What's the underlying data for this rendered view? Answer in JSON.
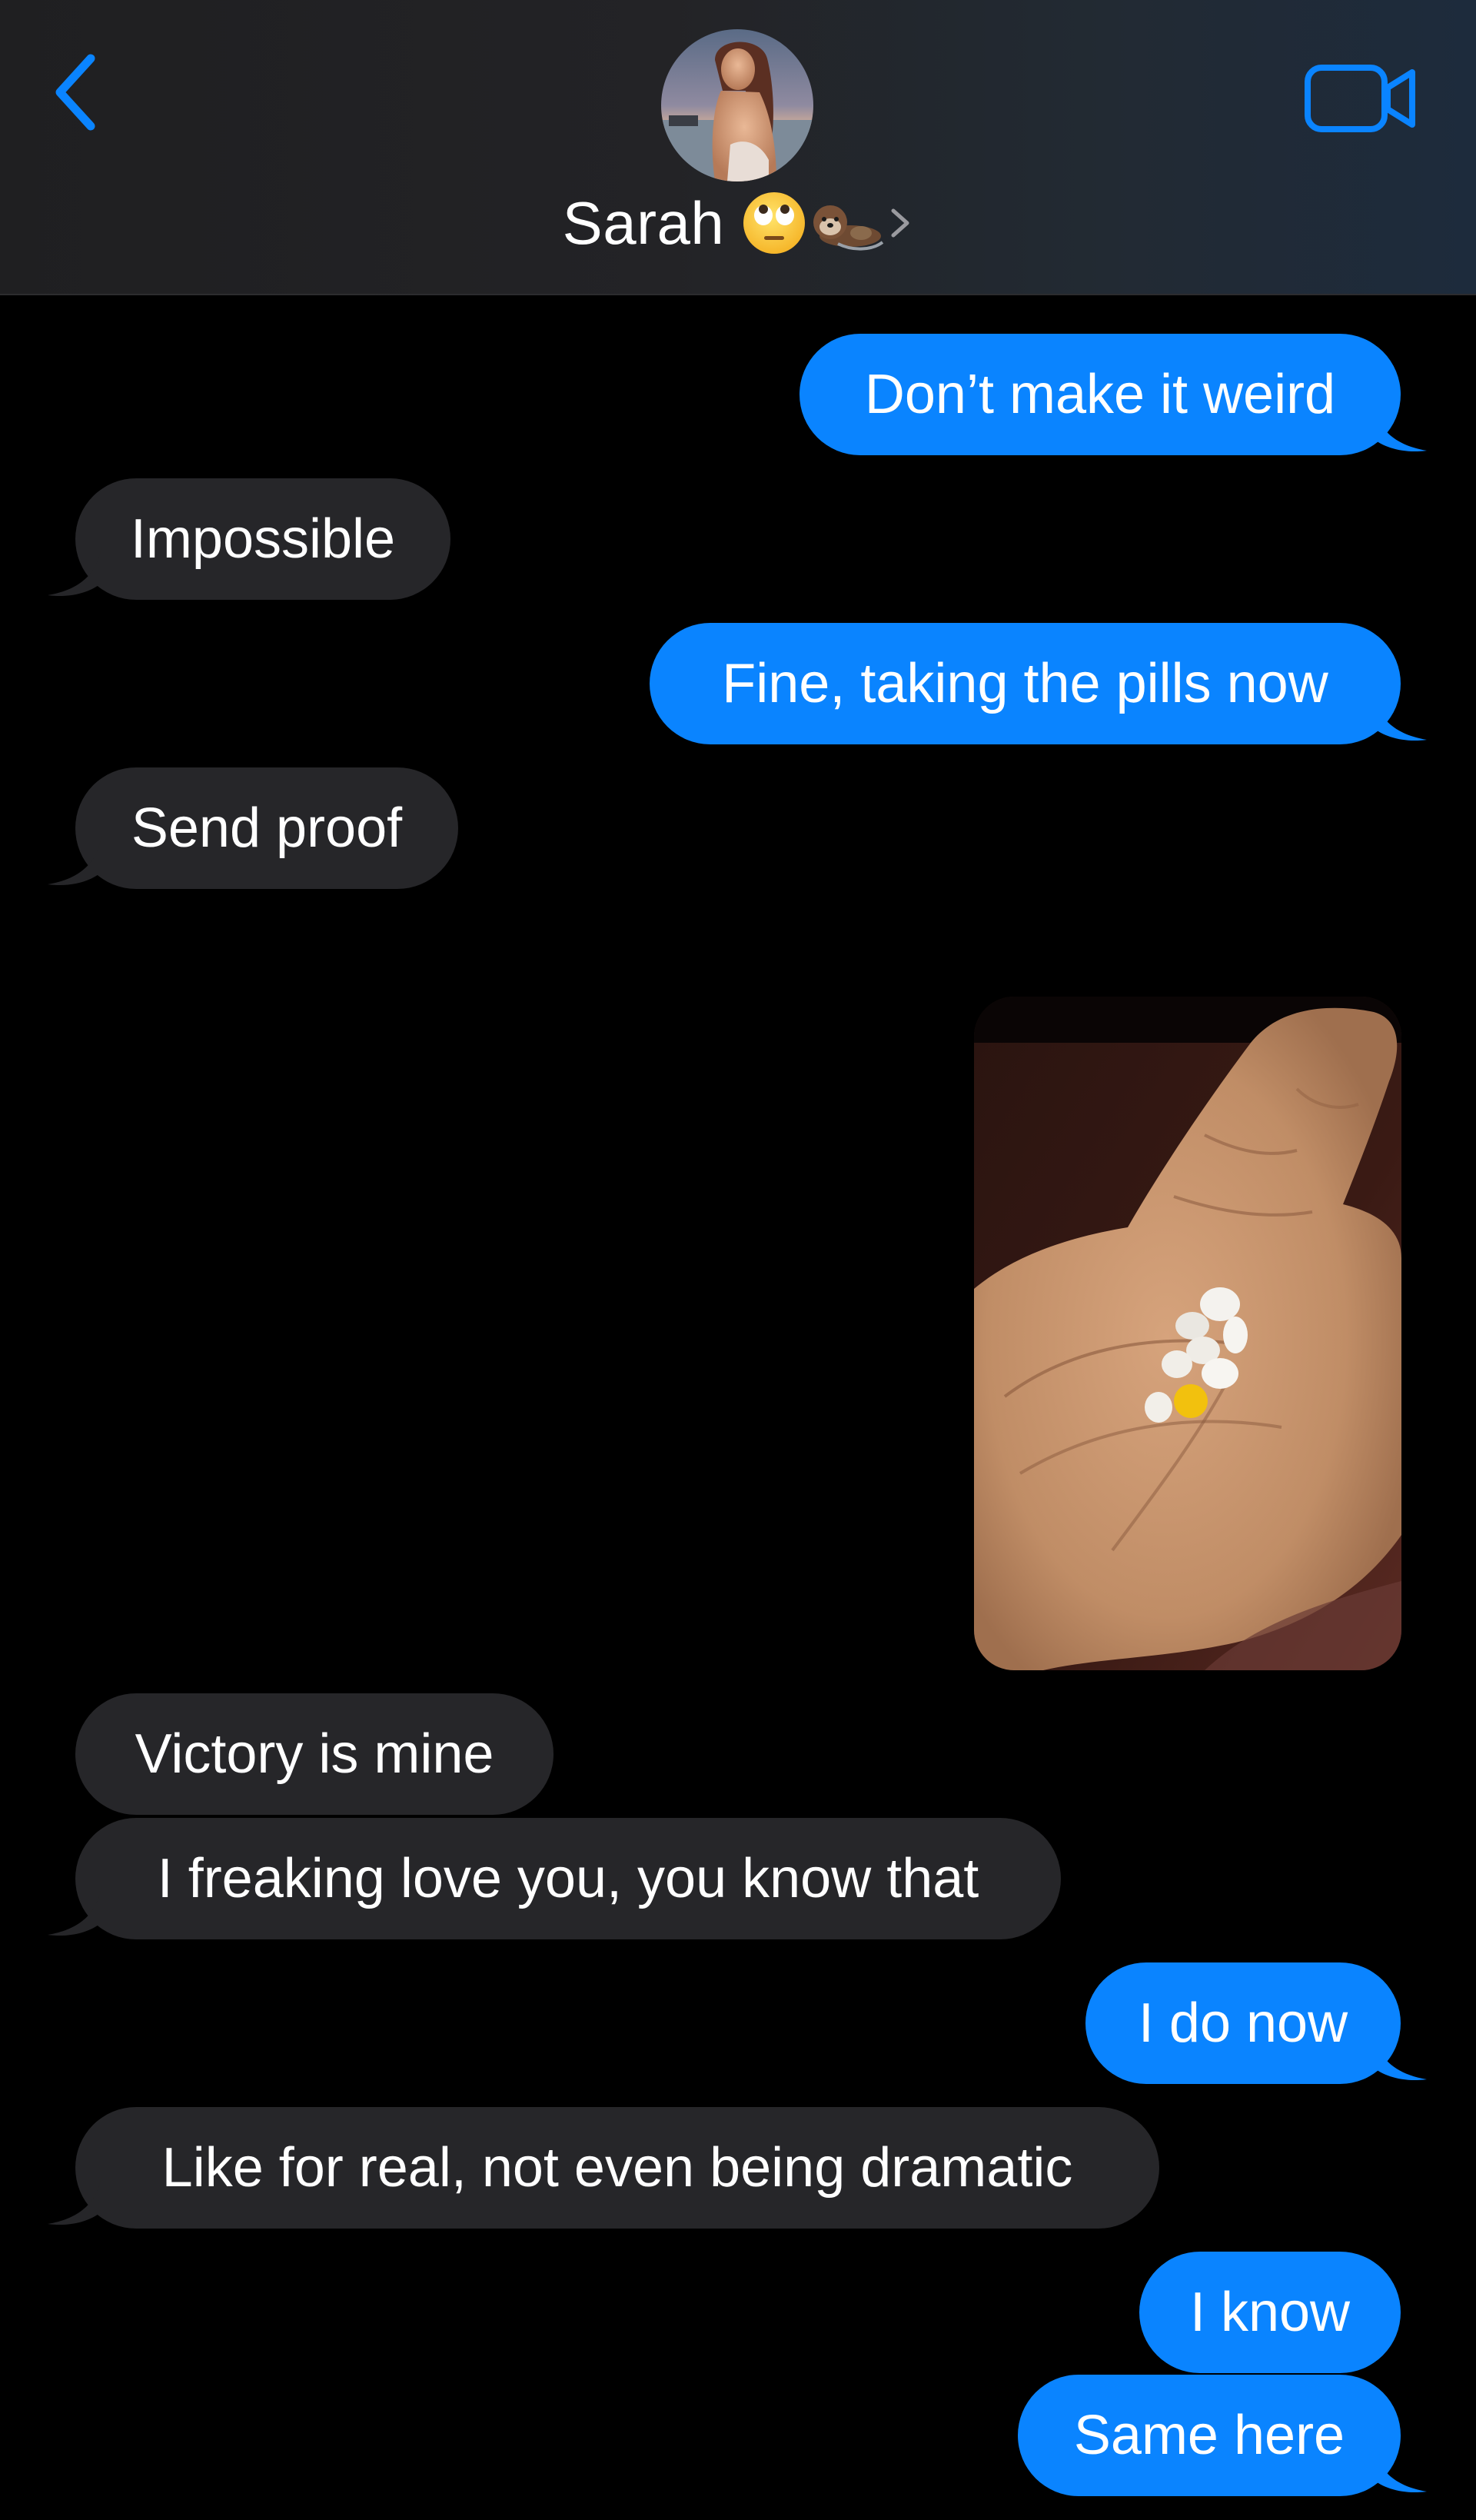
{
  "header": {
    "contact_name": "Sarah",
    "name_emojis": [
      "face-with-rolling-eyes",
      "otter"
    ],
    "back_icon": "chevron-left-icon",
    "video_icon": "video-camera-icon",
    "accent_color": "#0a84ff"
  },
  "messages": [
    {
      "type": "sent",
      "text": "Don’t make it weird"
    },
    {
      "type": "received",
      "text": "Impossible"
    },
    {
      "type": "sent",
      "text": "Fine, taking the pills now"
    },
    {
      "type": "received",
      "text": "Send proof"
    },
    {
      "type": "sent_photo",
      "description": "hand-holding-pills-photo"
    },
    {
      "type": "received",
      "text": "Victory is mine"
    },
    {
      "type": "received",
      "text": "I freaking love you, you know that"
    },
    {
      "type": "sent",
      "text": "I do now"
    },
    {
      "type": "received",
      "text": "Like for real, not even being dramatic"
    },
    {
      "type": "sent",
      "text": "I know"
    },
    {
      "type": "sent",
      "text": "Same here"
    }
  ],
  "colors": {
    "sent_bubble": "#0a84ff",
    "received_bubble": "#262629",
    "background": "#000000"
  }
}
